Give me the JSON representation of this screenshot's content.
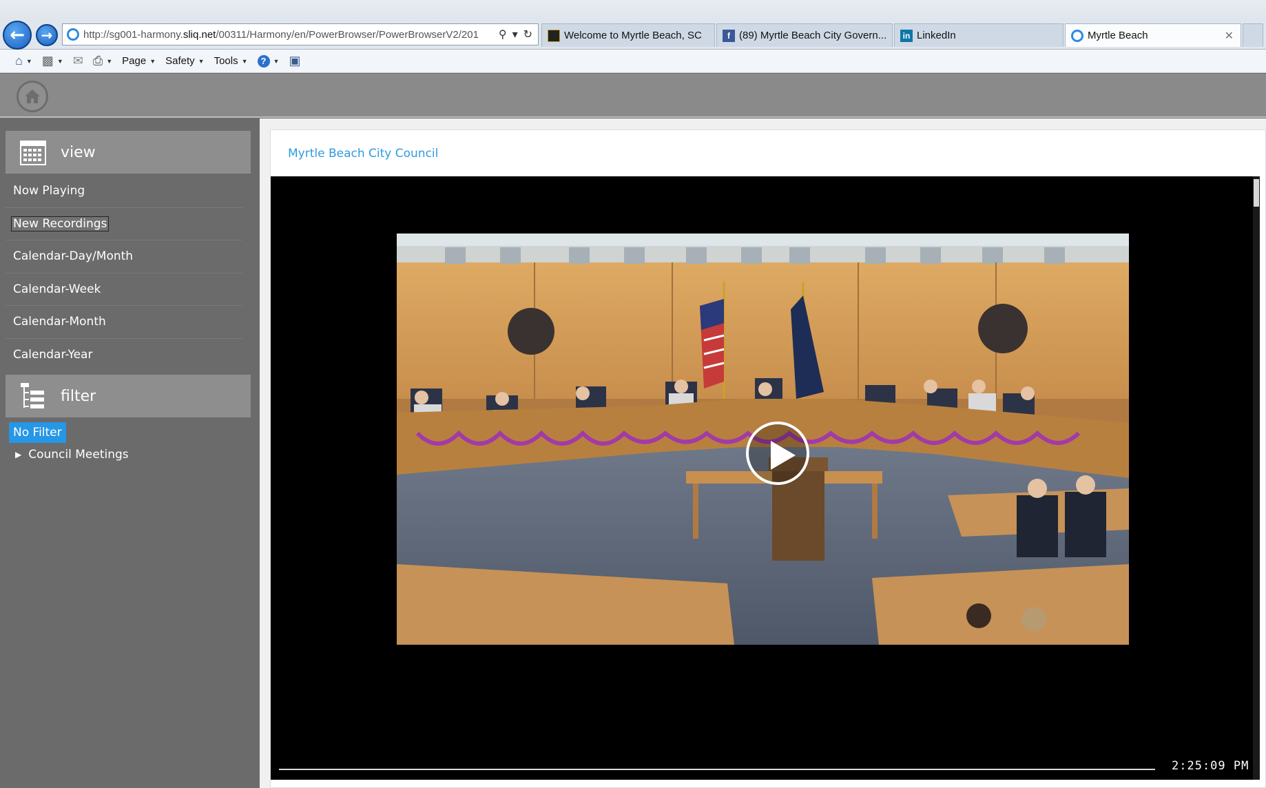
{
  "browser": {
    "url_prefix": "http://sg001-harmony.",
    "url_domain": "sliq.net",
    "url_suffix": "/00311/Harmony/en/PowerBrowser/PowerBrowserV2/201",
    "tabs": [
      {
        "label": "Welcome to Myrtle Beach, SC",
        "active": false
      },
      {
        "label": "(89) Myrtle Beach City Govern...",
        "active": false
      },
      {
        "label": "LinkedIn",
        "active": false
      },
      {
        "label": "Myrtle Beach",
        "active": true
      }
    ],
    "commands": [
      "Page",
      "Safety",
      "Tools"
    ]
  },
  "sidebar": {
    "view_title": "view",
    "view_items": [
      {
        "label": "Now Playing"
      },
      {
        "label": "New Recordings"
      },
      {
        "label": "Calendar-Day/Month"
      },
      {
        "label": "Calendar-Week"
      },
      {
        "label": "Calendar-Month"
      },
      {
        "label": "Calendar-Year"
      }
    ],
    "filter_title": "filter",
    "filter_selected": "No Filter",
    "tree_items": [
      {
        "label": "Council Meetings"
      }
    ]
  },
  "main": {
    "title": "Myrtle Beach City Council",
    "timestamp": "2:25:09 PM"
  },
  "colors": {
    "accent": "#2696e6",
    "sidebar_bg": "#6b6b6b",
    "header_bg": "#8a8a8a"
  }
}
